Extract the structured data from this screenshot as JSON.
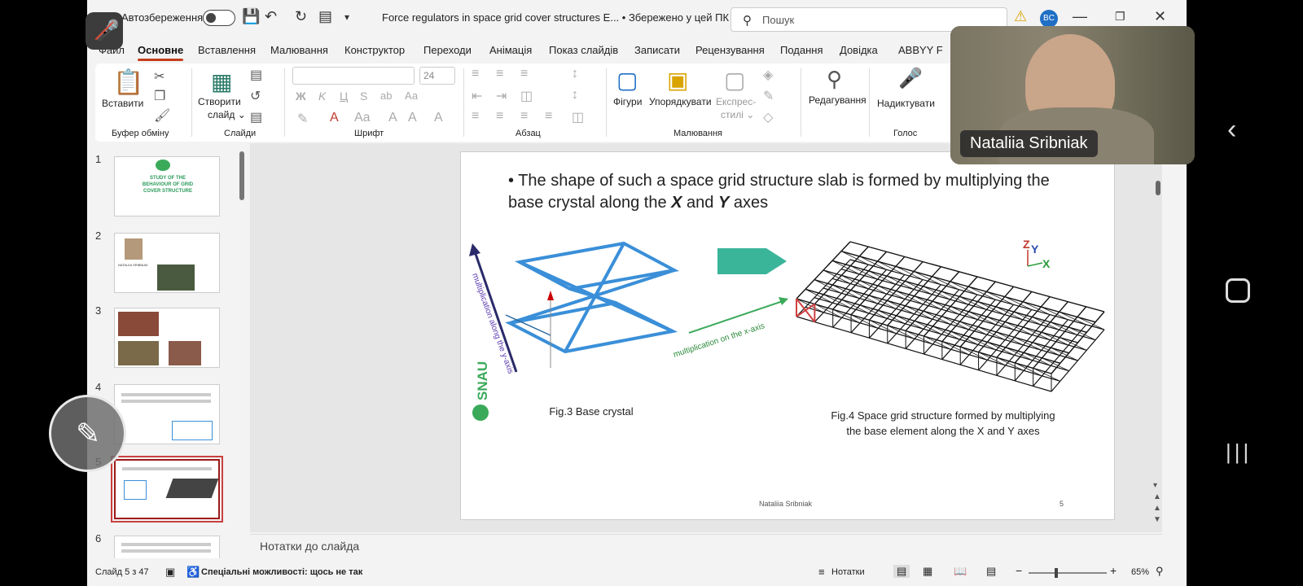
{
  "titlebar": {
    "autosave_label": "Автозбереження",
    "doc_title": "Force regulators in space grid cover structures E...  •  Збережено у цей ПК ⌄",
    "search_placeholder": "Пошук",
    "avatar_initials": "BC"
  },
  "tabs": [
    "Файл",
    "Основне",
    "Вставлення",
    "Малювання",
    "Конструктор",
    "Переходи",
    "Анімація",
    "Показ слайдів",
    "Записати",
    "Рецензування",
    "Подання",
    "Довідка",
    "ABBYY F"
  ],
  "ribbon": {
    "paste": "Вставити",
    "new_slide_1": "Створити",
    "new_slide_2": "слайд ⌄",
    "shapes": "Фігури",
    "arrange": "Упорядкувати",
    "quick_styles_1": "Експрес-",
    "quick_styles_2": "стилі ⌄",
    "editing": "Редагування",
    "dictate": "Надиктувати",
    "font_size": "24",
    "groups": {
      "clipboard": "Буфер обміну",
      "slides": "Слайди",
      "font": "Шрифт",
      "paragraph": "Абзац",
      "drawing": "Малювання",
      "voice": "Голос"
    }
  },
  "thumbnails": [
    {
      "num": "1",
      "text": "STUDY OF THE BEHAVIOUR OF GRID COVER STRUCTURE"
    },
    {
      "num": "2",
      "text": "NATALIIA SRIBNIAK"
    },
    {
      "num": "3",
      "text": ""
    },
    {
      "num": "4",
      "text": ""
    },
    {
      "num": "5",
      "text": ""
    },
    {
      "num": "6",
      "text": ""
    }
  ],
  "slide": {
    "bullet_part1": "The shape of such a space grid structure slab is formed by multiplying the base crystal along the ",
    "bullet_x": "X",
    "bullet_and": " and ",
    "bullet_y": "Y",
    "bullet_end": " axes",
    "fig3_caption": "Fig.3 Base crystal",
    "fig4_caption": "Fig.4 Space grid structure formed by multiplying the base element along the X and Y axes",
    "y_axis_label": "multiplication along the y-axis",
    "x_axis_label": "multiplication on the x-axis",
    "logo_text": "SNAU",
    "axes_z": "Z",
    "axes_y": "Y",
    "axes_x": "X",
    "footer_name": "Nataliia Sribniak",
    "footer_num": "5"
  },
  "notes_placeholder": "Нотатки до слайда",
  "status": {
    "slide_count": "Слайд 5 з 47",
    "accessibility": "Спеціальні можливості: щось не так",
    "notes": "Нотатки",
    "zoom": "65%"
  },
  "video": {
    "participant_name": "Nataliia Sribniak"
  },
  "colors": {
    "accent": "#c43e1c",
    "selection": "#9e1a1a",
    "crystal_blue": "#3a8fd8",
    "arrow_green": "#3aaa5a",
    "teal": "#3bb59a"
  }
}
